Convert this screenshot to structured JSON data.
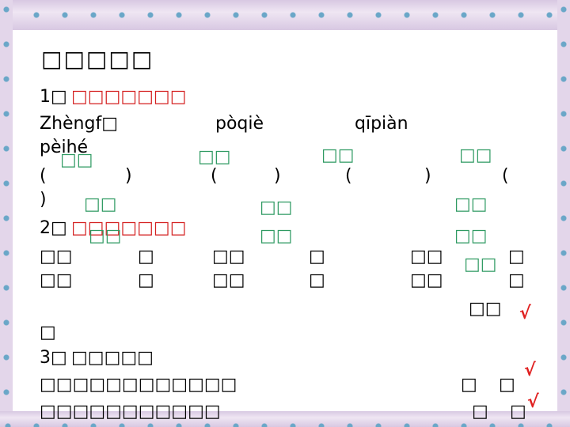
{
  "heading": "□□□□□",
  "q1": {
    "num": "1□",
    "prompt": "□□□□□□□",
    "pinyin": [
      "Zhèngf□",
      "pòqiè",
      "qīpiàn",
      "pèihé"
    ],
    "parens": [
      "(",
      ")",
      "(",
      ")",
      "(",
      ")",
      "(",
      ")"
    ],
    "answers": [
      "□□",
      "□□",
      "□□",
      "□□",
      "□□",
      "□□",
      "□□"
    ]
  },
  "q2": {
    "num": "2□",
    "prompt": "□□□□□□□",
    "row1": [
      "□□",
      "□",
      "□□",
      "□",
      "□□",
      "□"
    ],
    "row2": [
      "□□",
      "□",
      "□□",
      "□",
      "□□",
      "□"
    ],
    "answers": [
      "□□",
      "□□",
      "□□",
      "□□"
    ],
    "tail": "□"
  },
  "q3": {
    "num": "3□",
    "prompt": "□□□□□",
    "line1": "□□□□□□□□□□□□",
    "line2": "□□□□□□□□□□□",
    "marks1": [
      "□",
      "□"
    ],
    "marks2": [
      "□",
      "□"
    ]
  },
  "checkmark": "√"
}
